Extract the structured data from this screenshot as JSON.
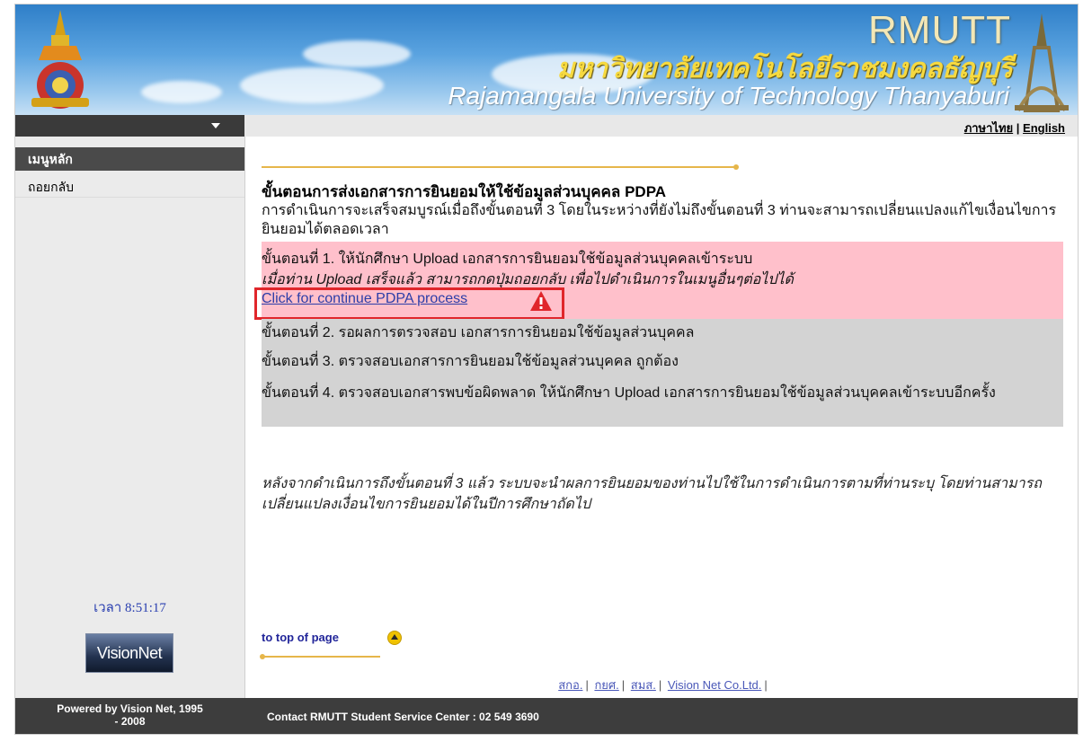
{
  "header": {
    "brand": "RMUTT",
    "thai_name": "มหาวิทยาลัยเทคโนโลยีราชมงคลธัญบุรี",
    "english_name": "Rajamangala University of Technology Thanyaburi"
  },
  "nav": {
    "lang_thai": "ภาษาไทย",
    "separator": "|",
    "lang_english": "English"
  },
  "sidebar": {
    "menu_title": "เมนูหลัก",
    "items": [
      {
        "label": "ถอยกลับ"
      }
    ],
    "clock": "เวลา 8:51:17",
    "vision_button": "VisionNet"
  },
  "main": {
    "title": "ขั้นตอนการส่งเอกสารการยินยอมให้ใช้ข้อมูลส่วนบุคคล PDPA",
    "description": "การดำเนินการจะเสร็จสมบูรณ์เมื่อถึงขั้นตอนที่ 3 โดยในระหว่างที่ยังไม่ถึงขั้นตอนที่ 3 ท่านจะสามารถเปลี่ยนแปลงแก้ไขเงื่อนไขการยินยอมได้ตลอดเวลา",
    "step1": "ขั้นตอนที่ 1. ให้นักศึกษา Upload เอกสารการยินยอมใช้ข้อมูลส่วนบุคคลเข้าระบบ",
    "step1_note": "เมื่อท่าน Upload เสร็จแล้ว สามารถกดปุ่มถอยกลับ เพื่อไปดำเนินการในเมนูอื่นๆต่อไปได้",
    "pdpa_link": "Click for continue PDPA process",
    "step2": "ขั้นตอนที่ 2. รอผลการตรวจสอบ เอกสารการยินยอมใช้ข้อมูลส่วนบุคคล",
    "step3": "ขั้นตอนที่ 3. ตรวจสอบเอกสารการยินยอมใช้ข้อมูลส่วนบุคคล ถูกต้อง",
    "step4": "ขั้นตอนที่ 4. ตรวจสอบเอกสารพบข้อผิดพลาด ให้นักศึกษา Upload เอกสารการยินยอมใช้ข้อมูลส่วนบุคคลเข้าระบบอีกครั้ง",
    "after_text": "หลังจากดำเนินการถึงขั้นตอนที่ 3 แล้ว ระบบจะนำผลการยินยอมของท่านไปใช้ในการดำเนินการตามที่ท่านระบุ โดยท่านสามารถเปลี่ยนแปลงเงื่อนไขการยินยอมได้ในปีการศึกษาถัดไป",
    "to_top": "to top of page"
  },
  "footer_links": [
    "สกอ.",
    "กยศ.",
    "สมส.",
    "Vision Net Co.Ltd."
  ],
  "footer": {
    "powered_line1": "Powered by Vision Net, 1995",
    "powered_line2": "- 2008",
    "contact": "Contact RMUTT Student Service Center : 02 549 3690"
  },
  "colors": {
    "step1_bg": "#ffc0cb",
    "step_gray_bg": "#d3d3d3",
    "highlight_border": "#e0262b",
    "link": "#2c3ea8"
  }
}
